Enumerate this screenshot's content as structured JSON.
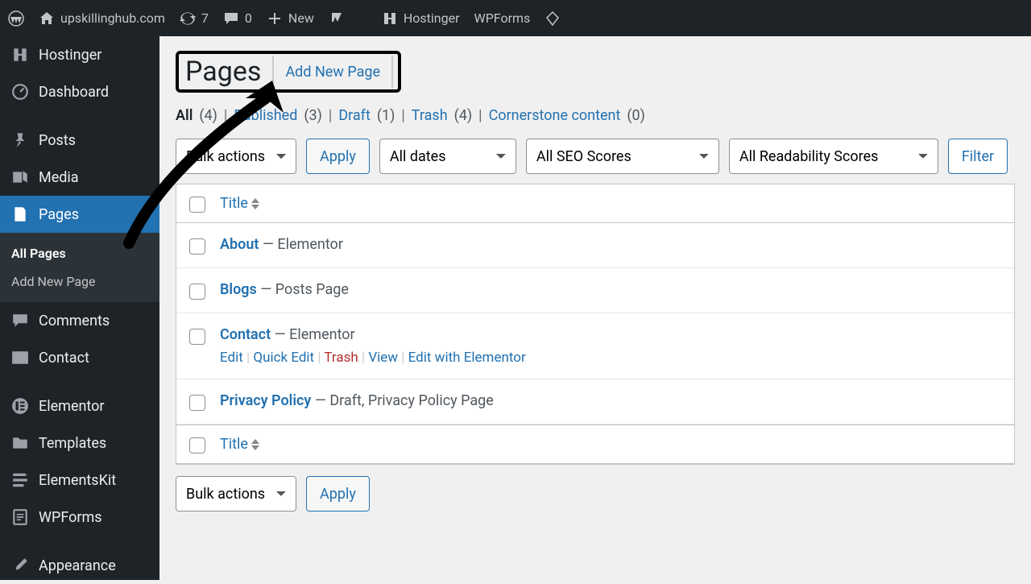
{
  "toolbar": {
    "site_name": "upskillinghub.com",
    "updates_count": "7",
    "comments_count": "0",
    "new_label": "New",
    "hostinger_label": "Hostinger",
    "wpforms_label": "WPForms"
  },
  "sidebar": {
    "items": [
      {
        "id": "hostinger",
        "label": "Hostinger"
      },
      {
        "id": "dashboard",
        "label": "Dashboard"
      },
      {
        "id": "posts",
        "label": "Posts"
      },
      {
        "id": "media",
        "label": "Media"
      },
      {
        "id": "pages",
        "label": "Pages"
      },
      {
        "id": "comments",
        "label": "Comments"
      },
      {
        "id": "contact",
        "label": "Contact"
      },
      {
        "id": "elementor",
        "label": "Elementor"
      },
      {
        "id": "templates",
        "label": "Templates"
      },
      {
        "id": "elementskit",
        "label": "ElementsKit"
      },
      {
        "id": "wpforms",
        "label": "WPForms"
      },
      {
        "id": "appearance",
        "label": "Appearance"
      }
    ],
    "submenu": {
      "all_pages": "All Pages",
      "add_new": "Add New Page"
    }
  },
  "header": {
    "title": "Pages",
    "add_new_button": "Add New Page"
  },
  "status_filters": [
    {
      "label": "All",
      "count": "(4)",
      "current": true
    },
    {
      "label": "Published",
      "count": "(3)"
    },
    {
      "label": "Draft",
      "count": "(1)"
    },
    {
      "label": "Trash",
      "count": "(4)"
    },
    {
      "label": "Cornerstone content",
      "count": "(0)"
    }
  ],
  "filters": {
    "bulk_actions": "Bulk actions",
    "apply": "Apply",
    "all_dates": "All dates",
    "all_seo": "All SEO Scores",
    "all_readability": "All Readability Scores",
    "filter": "Filter"
  },
  "columns": {
    "title": "Title"
  },
  "rows": [
    {
      "title": "About",
      "state": " — Elementor"
    },
    {
      "title": "Blogs",
      "state": " — Posts Page"
    },
    {
      "title": "Contact",
      "state": " — Elementor",
      "actions": true
    },
    {
      "title": "Privacy Policy",
      "state": " — Draft, Privacy Policy Page"
    }
  ],
  "row_actions": {
    "edit": "Edit",
    "quick_edit": "Quick Edit",
    "trash": "Trash",
    "view": "View",
    "edit_elementor": "Edit with Elementor"
  }
}
